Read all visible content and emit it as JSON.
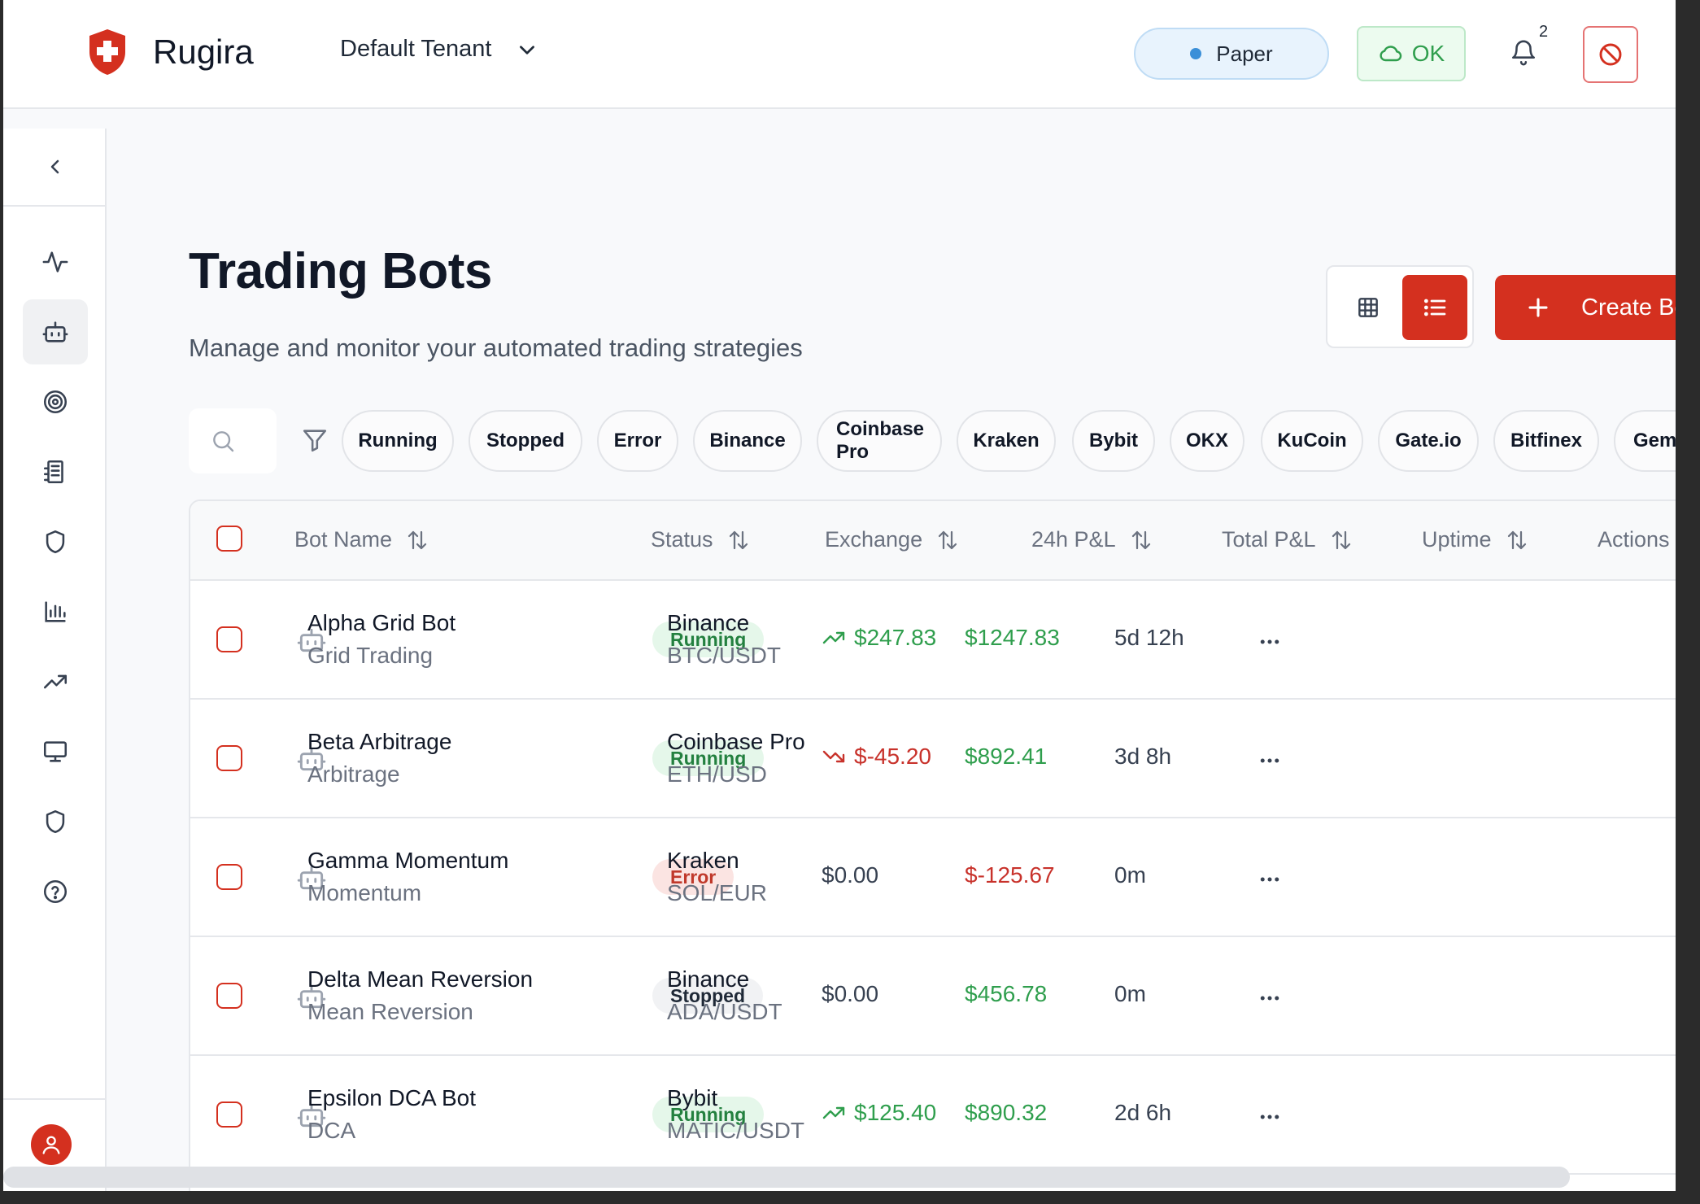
{
  "header": {
    "brand": "Rugira",
    "tenant": "Default Tenant",
    "mode": "Paper",
    "status": "OK",
    "notification_count": "2"
  },
  "sidebar": {
    "icons": [
      "activity-icon",
      "bot-icon",
      "target-icon",
      "document-icon",
      "shield-icon",
      "bar-chart-icon",
      "trending-up-icon",
      "monitor-icon",
      "shield-icon",
      "help-icon"
    ],
    "active_index": 1
  },
  "page": {
    "title": "Trading Bots",
    "subtitle": "Manage and monitor your automated trading strategies",
    "create_button": "Create Bot"
  },
  "filters": [
    "Running",
    "Stopped",
    "Error",
    "Binance",
    "Coinbase Pro",
    "Kraken",
    "Bybit",
    "OKX",
    "KuCoin",
    "Gate.io",
    "Bitfinex",
    "Gemini"
  ],
  "table": {
    "columns": {
      "name": "Bot Name",
      "status": "Status",
      "exchange": "Exchange",
      "pnl24": "24h P&L",
      "total": "Total P&L",
      "uptime": "Uptime",
      "actions": "Actions"
    },
    "rows": [
      {
        "name": "Alpha Grid Bot",
        "strategy": "Grid Trading",
        "status": "Running",
        "exchange": "Binance",
        "pair": "BTC/USDT",
        "pnl24": "$247.83",
        "pnl24_trend": "up",
        "total": "$1247.83",
        "total_trend": "up",
        "uptime": "5d 12h"
      },
      {
        "name": "Beta Arbitrage",
        "strategy": "Arbitrage",
        "status": "Running",
        "exchange": "Coinbase Pro",
        "pair": "ETH/USD",
        "pnl24": "$-45.20",
        "pnl24_trend": "down",
        "total": "$892.41",
        "total_trend": "up",
        "uptime": "3d 8h"
      },
      {
        "name": "Gamma Momentum",
        "strategy": "Momentum",
        "status": "Error",
        "exchange": "Kraken",
        "pair": "SOL/EUR",
        "pnl24": "$0.00",
        "pnl24_trend": "flat",
        "total": "$-125.67",
        "total_trend": "down",
        "uptime": "0m"
      },
      {
        "name": "Delta Mean Reversion",
        "strategy": "Mean Reversion",
        "status": "Stopped",
        "exchange": "Binance",
        "pair": "ADA/USDT",
        "pnl24": "$0.00",
        "pnl24_trend": "flat",
        "total": "$456.78",
        "total_trend": "up",
        "uptime": "0m"
      },
      {
        "name": "Epsilon DCA Bot",
        "strategy": "DCA",
        "status": "Running",
        "exchange": "Bybit",
        "pair": "MATIC/USDT",
        "pnl24": "$125.40",
        "pnl24_trend": "up",
        "total": "$890.32",
        "total_trend": "up",
        "uptime": "2d 6h"
      }
    ]
  },
  "colors": {
    "accent": "#d4301f",
    "positive": "#2f9e4d",
    "negative": "#c8322b"
  }
}
